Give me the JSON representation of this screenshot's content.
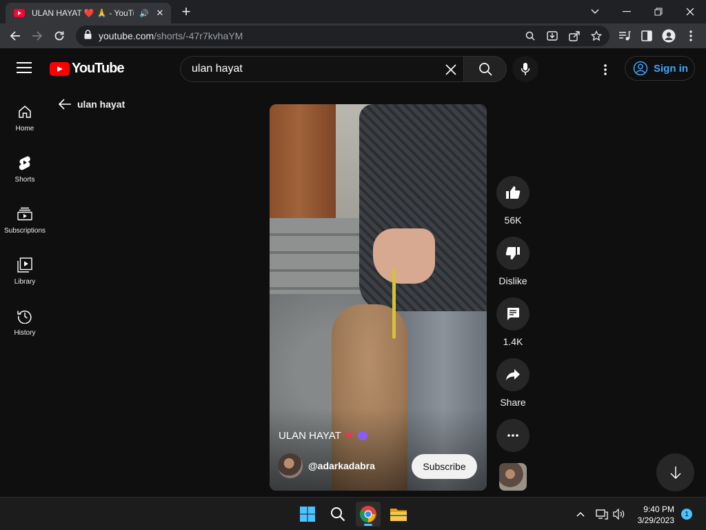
{
  "browser": {
    "tab": {
      "title": "ULAN HAYAT ❤️ 🙏 - YouTube",
      "favicon": "youtube-icon",
      "audio_indicator": "🔊",
      "close": "✕"
    },
    "new_tab": "+",
    "window_controls": {
      "dropdown": "chevron-down-icon",
      "minimize": "minimize-icon",
      "restore": "restore-icon",
      "close": "close-icon"
    },
    "address": {
      "host": "youtube.com",
      "path": "/shorts/-47r7kvhaYM"
    }
  },
  "youtube": {
    "logo_text": "YouTube",
    "search": {
      "value": "ulan hayat",
      "placeholder": "Search"
    },
    "signin_label": "Sign in",
    "guide": [
      {
        "label": "Home",
        "icon": "home-icon"
      },
      {
        "label": "Shorts",
        "icon": "shorts-icon"
      },
      {
        "label": "Subscriptions",
        "icon": "subscriptions-icon"
      },
      {
        "label": "Library",
        "icon": "library-icon"
      },
      {
        "label": "History",
        "icon": "history-icon"
      }
    ],
    "back_label": "ulan hayat",
    "short": {
      "title": "ULAN HAYAT",
      "channel_handle": "@adarkadabra",
      "subscribe_label": "Subscribe"
    },
    "actions": {
      "like_count": "56K",
      "dislike_label": "Dislike",
      "comments_count": "1.4K",
      "share_label": "Share"
    }
  },
  "taskbar": {
    "time": "9:40 PM",
    "date": "3/29/2023",
    "notification_count": "1",
    "accent": "#4cc2ff"
  },
  "colors": {
    "background": "#0f0f0f",
    "youtube_red": "#ff0000",
    "link_blue": "#3ea6ff"
  }
}
